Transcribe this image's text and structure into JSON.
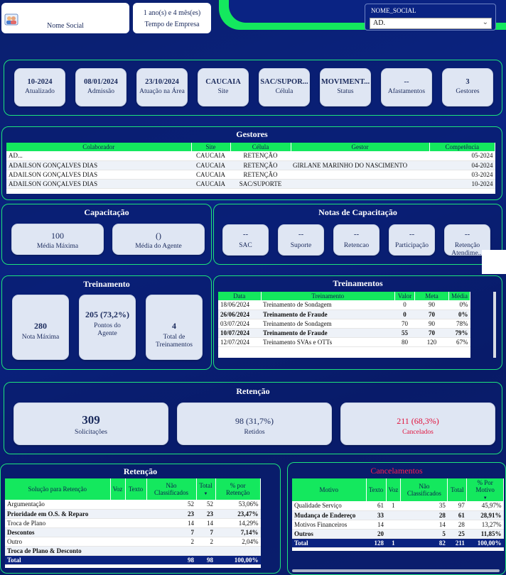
{
  "header": {
    "nome_social_label": "Nome Social",
    "tempo_value": "1 ano(s) e 4 mês(es)",
    "tempo_label": "Tempo de Empresa",
    "filter_label": "NOME_SOCIAL",
    "filter_value": "AD."
  },
  "info_cards": [
    {
      "value": "10-2024",
      "label": "Atualizado"
    },
    {
      "value": "08/01/2024",
      "label": "Admissão"
    },
    {
      "value": "23/10/2024",
      "label": "Atuação na Área"
    },
    {
      "value": "CAUCAIA",
      "label": "Site"
    },
    {
      "value": "SAC/SUPOR...",
      "label": "Célula"
    },
    {
      "value": "MOVIMENT...",
      "label": "Status"
    },
    {
      "value": "--",
      "label": "Afastamentos"
    },
    {
      "value": "3",
      "label": "Gestores"
    }
  ],
  "gestores": {
    "title": "Gestores",
    "columns": [
      "Colaborador",
      "Site",
      "Célula",
      "Gestor",
      "Competência"
    ],
    "rows": [
      [
        "AD...",
        "CAUCAIA",
        "RETENÇÃO",
        "",
        "05-2024"
      ],
      [
        "ADAILSON GONÇALVES DIAS",
        "CAUCAIA",
        "RETENÇÃO",
        "GIRLANE MARINHO DO NASCIMENTO",
        "04-2024"
      ],
      [
        "ADAILSON GONÇALVES DIAS",
        "CAUCAIA",
        "RETENÇÃO",
        "",
        "03-2024"
      ],
      [
        "ADAILSON GONÇALVES DIAS",
        "CAUCAIA",
        "SAC/SUPORTE",
        "",
        "10-2024"
      ]
    ]
  },
  "capacitacao": {
    "title": "Capacitação",
    "cards": [
      {
        "value": "100",
        "label": "Média Máxima"
      },
      {
        "value": "()",
        "label": "Média do Agente"
      }
    ]
  },
  "notas": {
    "title": "Notas de Capacitação",
    "cards": [
      {
        "value": "--",
        "label": "SAC"
      },
      {
        "value": "--",
        "label": "Suporte"
      },
      {
        "value": "--",
        "label": "Retencao"
      },
      {
        "value": "--",
        "label": "Participação"
      },
      {
        "value": "--",
        "label": "Retenção Atendime..."
      }
    ]
  },
  "treinamento": {
    "title": "Treinamento",
    "cards": [
      {
        "value": "280",
        "label": "Nota Máxima"
      },
      {
        "value": "205 (73,2%)",
        "label": "Pontos do Agente"
      },
      {
        "value": "4",
        "label": "Total de Treinamentos"
      }
    ]
  },
  "treinamentos": {
    "title": "Treinamentos",
    "columns": [
      "Data",
      "Treinamento",
      "Valor",
      "Meta",
      "Média"
    ],
    "rows": [
      [
        "18/06/2024",
        "Treinamento de Sondagem",
        "0",
        "90",
        "0%"
      ],
      [
        "26/06/2024",
        "Treinamento de Fraude",
        "0",
        "70",
        "0%"
      ],
      [
        "03/07/2024",
        "Treinamento de Sondagem",
        "70",
        "90",
        "78%"
      ],
      [
        "10/07/2024",
        "Treinamento de Fraude",
        "55",
        "70",
        "79%"
      ],
      [
        "12/07/2024",
        "Treinamento SVAs e OTTs",
        "80",
        "120",
        "67%"
      ]
    ]
  },
  "retencao": {
    "title": "Retenção",
    "solicitacoes_value": "309",
    "solicitacoes_label": "Solicitações",
    "retidos_value": "98 (31,7%)",
    "retidos_label": "Retidos",
    "cancelados_value": "211 (68,3%)",
    "cancelados_label": "Cancelados"
  },
  "retencao_table": {
    "title": "Retenção",
    "columns": [
      "Solução para Retenção",
      "Voz",
      "Texto",
      "Não Classificados",
      "Total",
      "% por Retenção"
    ],
    "rows": [
      [
        "Argumentação",
        "",
        "",
        "52",
        "52",
        "53,06%"
      ],
      [
        "Prioridade em O.S. & Reparo",
        "",
        "",
        "23",
        "23",
        "23,47%"
      ],
      [
        "Troca de Plano",
        "",
        "",
        "14",
        "14",
        "14,29%"
      ],
      [
        "Descontos",
        "",
        "",
        "7",
        "7",
        "7,14%"
      ],
      [
        "Outro",
        "",
        "",
        "2",
        "2",
        "2,04%"
      ],
      [
        "Troca de Plano & Desconto",
        "",
        "",
        "",
        "",
        ""
      ]
    ],
    "total": [
      "Total",
      "",
      "",
      "98",
      "98",
      "100,00%"
    ]
  },
  "cancelamentos": {
    "title": "Cancelamentos",
    "columns": [
      "Motivo",
      "Texto",
      "Voz",
      "Não Classificados",
      "Total",
      "% Por Motivo"
    ],
    "rows": [
      [
        "Qualidade Serviço",
        "61",
        "1",
        "35",
        "97",
        "45,97%"
      ],
      [
        "Mudança de Endereço",
        "33",
        "",
        "28",
        "61",
        "28,91%"
      ],
      [
        "Motivos Financeiros",
        "14",
        "",
        "14",
        "28",
        "13,27%"
      ],
      [
        "Outros",
        "20",
        "",
        "5",
        "25",
        "11,85%"
      ]
    ],
    "total": [
      "Total",
      "128",
      "1",
      "82",
      "211",
      "100,00%"
    ]
  },
  "colors": {
    "accent": "#14e85e",
    "background": "#0a2383",
    "cancel_red": "#e0123c"
  }
}
